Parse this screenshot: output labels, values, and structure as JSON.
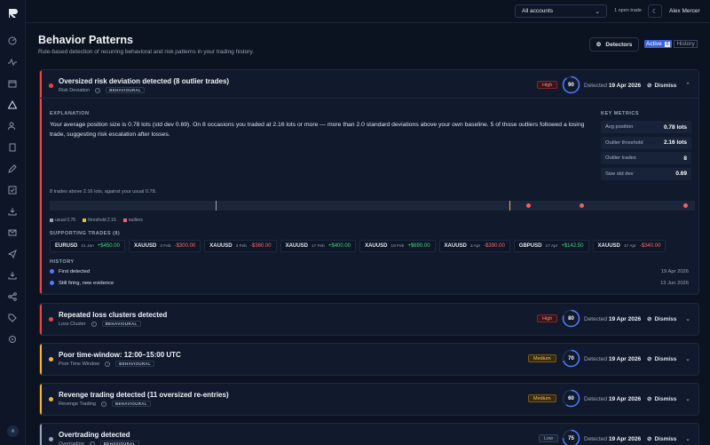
{
  "topbar": {
    "account_select": "All accounts",
    "open_trade": "1 open trade",
    "user_name": "Alex Mercer"
  },
  "sidebar": {
    "avatar_initial": "A"
  },
  "page": {
    "title": "Behavior Patterns",
    "subtitle": "Rule-based detection of recurring behavioral and risk patterns in your trading history.",
    "detectors_label": "Detectors",
    "tab_active_label": "Active",
    "tab_active_count": "6",
    "tab_history_label": "History"
  },
  "expanded": {
    "title": "Oversized risk deviation detected (8 outlier trades)",
    "category": "Risk Deviation",
    "tag": "BEHAVIOURAL",
    "severity": "High",
    "score": 90,
    "detected_label": "Detected",
    "detected_date": "19 Apr 2026",
    "dismiss_label": "Dismiss",
    "explanation_label": "EXPLANATION",
    "explanation": "Your average position size is 0.78 lots (std dev 0.69). On 8 occasions you traded at 2.16 lots or more — more than 2.0 standard deviations above your own baseline. 5 of those outliers followed a losing trade, suggesting risk escalation after losses.",
    "key_metrics_label": "KEY METRICS",
    "metrics": [
      {
        "k": "Avg position",
        "v": "0.78 lots"
      },
      {
        "k": "Outlier threshold",
        "v": "2.16 lots"
      },
      {
        "k": "Outlier trades",
        "v": "8"
      },
      {
        "k": "Size std dev",
        "v": "0.69"
      }
    ],
    "chart_caption": "8 trades above 2.16 lots, against your usual 0.78.",
    "legend": {
      "usual": "usual 0.78",
      "threshold": "threshold 2.16",
      "outliers": "outliers"
    },
    "supporting_label": "SUPPORTING TRADES (8)",
    "trades": [
      {
        "sym": "EURUSD",
        "date": "21 Jan",
        "pnl": "+$450.00",
        "pos": true
      },
      {
        "sym": "XAUUSD",
        "date": "3 Feb",
        "pnl": "-$300.00",
        "pos": false
      },
      {
        "sym": "XAUUSD",
        "date": "3 Feb",
        "pnl": "-$360.00",
        "pos": false
      },
      {
        "sym": "XAUUSD",
        "date": "17 Feb",
        "pnl": "+$400.00",
        "pos": true
      },
      {
        "sym": "XAUUSD",
        "date": "18 Feb",
        "pnl": "+$690.00",
        "pos": true
      },
      {
        "sym": "XAUUSD",
        "date": "3 Apr",
        "pnl": "-$390.00",
        "pos": false
      },
      {
        "sym": "GBPUSD",
        "date": "17 Apr",
        "pnl": "+$142.50",
        "pos": true
      },
      {
        "sym": "XAUUSD",
        "date": "17 Apr",
        "pnl": "-$340.00",
        "pos": false
      }
    ],
    "history_label": "HISTORY",
    "history": [
      {
        "event": "First detected",
        "date": "19 Apr 2026"
      },
      {
        "event": "Still firing, new evidence",
        "date": "13 Jun 2026"
      }
    ]
  },
  "cards": [
    {
      "title": "Repeated loss clusters detected",
      "category": "Loss Cluster",
      "tag": "BEHAVIOURAL",
      "severity": "High",
      "sev_class": "high",
      "score": 80,
      "detected_label": "Detected",
      "detected_date": "19 Apr 2026",
      "dismiss_label": "Dismiss",
      "color": "#ef4444"
    },
    {
      "title": "Poor time-window: 12:00–15:00 UTC",
      "category": "Poor Time Window",
      "tag": "BEHAVIOURAL",
      "severity": "Medium",
      "sev_class": "med",
      "score": 70,
      "detected_label": "Detected",
      "detected_date": "19 Apr 2026",
      "dismiss_label": "Dismiss",
      "color": "#f5b53a"
    },
    {
      "title": "Revenge trading detected (11 oversized re-entries)",
      "category": "Revenge Trading",
      "tag": "BEHAVIOURAL",
      "severity": "Medium",
      "sev_class": "med",
      "score": 60,
      "detected_label": "Detected",
      "detected_date": "19 Apr 2026",
      "dismiss_label": "Dismiss",
      "color": "#f5b53a"
    },
    {
      "title": "Overtrading detected",
      "category": "Overtrading",
      "tag": "BEHAVIOURAL",
      "severity": "Low",
      "sev_class": "low",
      "score": 75,
      "detected_label": "Detected",
      "detected_date": "19 Apr 2026",
      "dismiss_label": "Dismiss",
      "color": "#9aa5b9"
    }
  ],
  "colors": {
    "accent": "#3a63d8",
    "high": "#ef4444",
    "medium": "#f5b53a",
    "gauge": "#4f7cff"
  }
}
